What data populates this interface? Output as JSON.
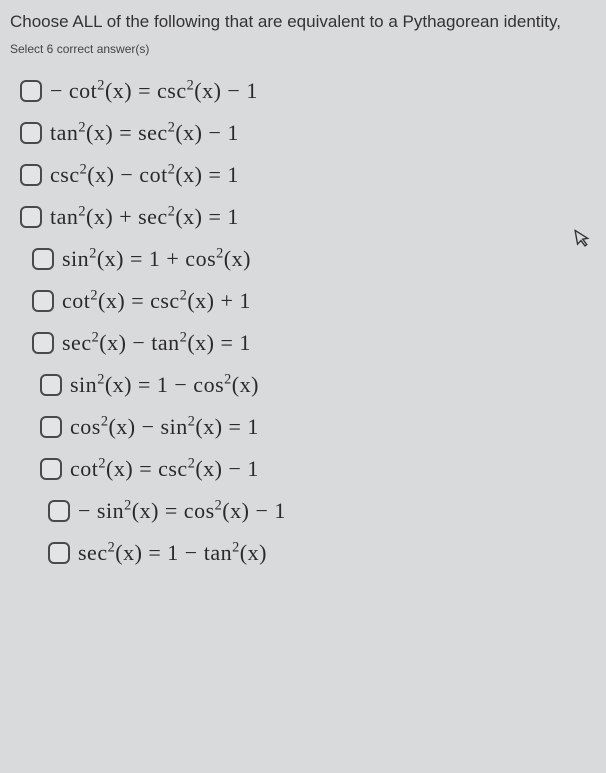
{
  "question": {
    "title": "Choose ALL of the following that are equivalent to a Pythagorean identity,",
    "instruction": "Select 6 correct answer(s)"
  },
  "options": [
    {
      "expr_html": "− cot<sup>2</sup>(x) = csc<sup>2</sup>(x) − 1"
    },
    {
      "expr_html": "tan<sup>2</sup>(x) = sec<sup>2</sup>(x) − 1"
    },
    {
      "expr_html": "csc<sup>2</sup>(x) − cot<sup>2</sup>(x) = 1"
    },
    {
      "expr_html": "tan<sup>2</sup>(x) + sec<sup>2</sup>(x) = 1"
    },
    {
      "expr_html": "sin<sup>2</sup>(x) = 1 + cos<sup>2</sup>(x)"
    },
    {
      "expr_html": "cot<sup>2</sup>(x) = csc<sup>2</sup>(x) + 1"
    },
    {
      "expr_html": "sec<sup>2</sup>(x) − tan<sup>2</sup>(x) = 1"
    },
    {
      "expr_html": "sin<sup>2</sup>(x) = 1 − cos<sup>2</sup>(x)"
    },
    {
      "expr_html": "cos<sup>2</sup>(x) − sin<sup>2</sup>(x) = 1"
    },
    {
      "expr_html": "cot<sup>2</sup>(x) = csc<sup>2</sup>(x) − 1"
    },
    {
      "expr_html": "− sin<sup>2</sup>(x) = cos<sup>2</sup>(x) − 1"
    },
    {
      "expr_html": "sec<sup>2</sup>(x) = 1 − tan<sup>2</sup>(x)"
    }
  ],
  "cursor_glyph": "↖"
}
